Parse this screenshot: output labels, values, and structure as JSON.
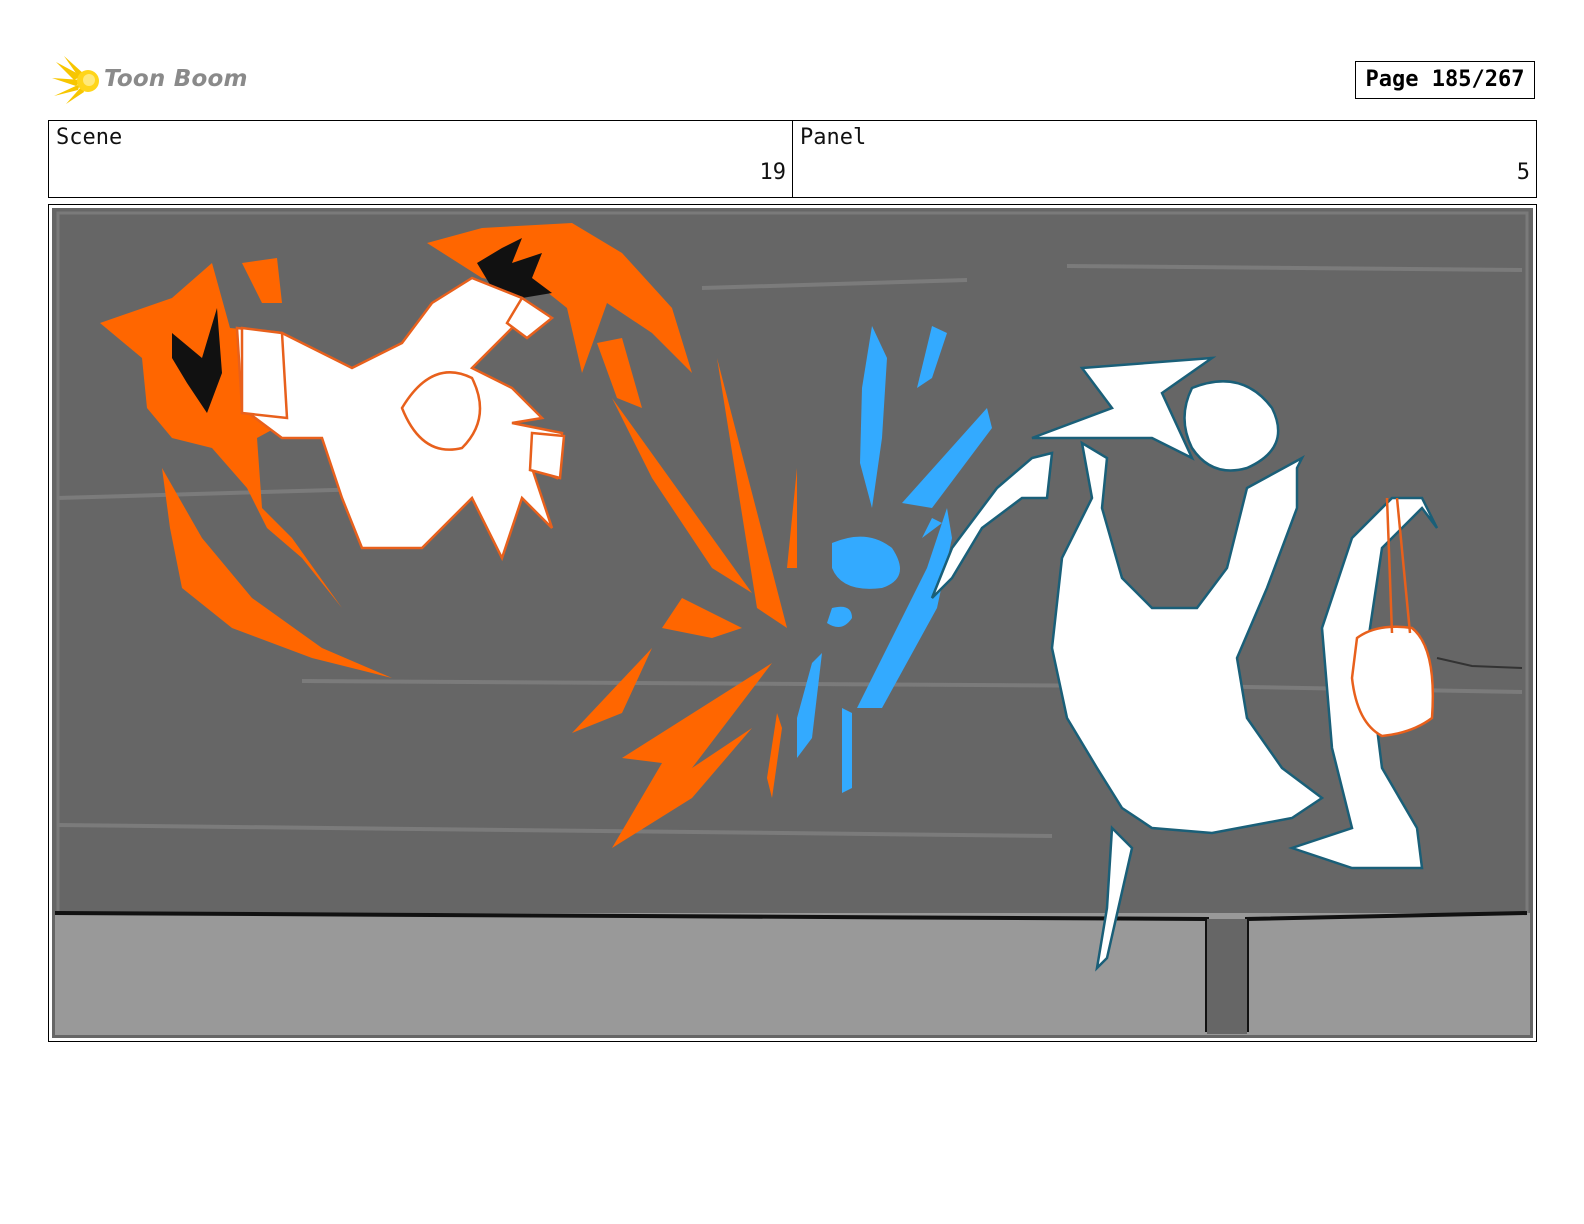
{
  "header": {
    "logo_text": "Toon Boom",
    "page_label": "Page 185/267"
  },
  "info": {
    "scene_label": "Scene",
    "scene_value": "19",
    "panel_label": "Panel",
    "panel_value": "5"
  },
  "colors": {
    "background": "#666666",
    "floor": "#999999",
    "fire_orange": "#ff6600",
    "water_blue": "#33aaff",
    "outline_teal": "#1a5f78"
  }
}
